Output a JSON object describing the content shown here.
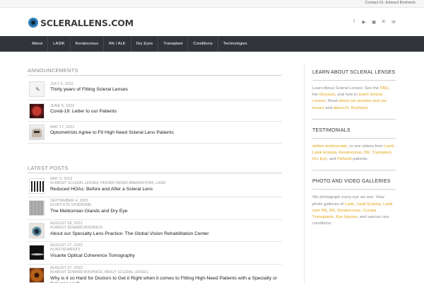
{
  "topbar": {
    "contact": "Contact Dr. Edward Boshnick"
  },
  "header": {
    "logo_text": "SCLERALLENS.COM",
    "social": [
      "facebook-icon",
      "youtube-icon",
      "instagram-icon",
      "linkedin-icon",
      "twitter-icon"
    ],
    "social_glyphs": [
      "f",
      "▶",
      "▣",
      "in",
      "✉"
    ]
  },
  "nav": {
    "items": [
      "About",
      "LASIK",
      "Keratoconus",
      "RK / ALK",
      "Dry Eyes",
      "Transplant",
      "Conditions",
      "Technologies"
    ]
  },
  "announcements": {
    "title": "ANNOUNCEMENTS",
    "items": [
      {
        "date": "JULY 6, 2022",
        "title": "Thirty years of Fitting Scleral Lenses"
      },
      {
        "date": "JUNE 5, 2022",
        "title": "Covid-19: Letter to our Patients"
      },
      {
        "date": "MAY 17, 2022",
        "title": "Optometrists Agree to Fit High Need Scleral Lens Patients"
      }
    ]
  },
  "latest": {
    "title": "LATEST POSTS",
    "items": [
      {
        "date": "MAY 2, 2023",
        "cats": "IN ABOUT SCLERAL LENSES, HIGHER ORDER ABERRATIONS, LASIK",
        "title": "Reduced HOAs: Before and After a Scleral Lens"
      },
      {
        "date": "SEPTEMBER 4, 2022",
        "cats": "IN DRY EYE SYNDROME",
        "title": "The Meibomian Glands and Dry Eye"
      },
      {
        "date": "AUGUST 28, 2022",
        "cats": "IN ABOUT EDWARD BOSHNICK",
        "title": "About our Specialty Lens Practice: The Global Vision Rehabilitation Center"
      },
      {
        "date": "AUGUST 27, 2022",
        "cats": "IN INSTRUMENTS",
        "title": "Visante Optical Coherence Tomography"
      },
      {
        "date": "AUGUST 27, 2022",
        "cats": "IN ABOUT EDWARD BOSHNICK, ABOUT SCLERAL LENSES",
        "title": "Why is it so Hard for Doctors to Get it Right when it comes to Fitting High-Need Patients with a Specialty or Scleral Lens?"
      }
    ]
  },
  "sidebar": {
    "learn": {
      "title": "LEARN ABOUT SCLERAL LENSES",
      "t1": "Learn About Scleral Lenses: See the",
      "l1": "FAQ",
      "t2": ", the",
      "l2": "Glossary",
      "t3": ", and how to",
      "l3": "Insert Scleral Lenses",
      "t4": ". Read",
      "l4": "about our practice and our lenses",
      "t5": "and",
      "l5": "about Dr. Boshnick",
      "t6": "."
    },
    "testimonials": {
      "title": "TESTIMONIALS",
      "l1": "written testimonials",
      "t1": ", or see videos from",
      "l2": "Lasik",
      "t2": ",",
      "l3": "Lasik Ectasia",
      "t3": ",",
      "l4": "Keratoconus",
      "t4": ",",
      "l5": "RK",
      "t5": ",",
      "l6": "Transplant",
      "t6": ",",
      "l7": "Dry Eye",
      "t7": ", and",
      "l8": "Pellucid",
      "t8": "patients."
    },
    "gallery": {
      "title": "PHOTO AND VIDEO GALLERIES",
      "t1": "We photograph every eye we see. View photo galleries of",
      "l1": "Lasik",
      "t2": ",",
      "l2": "Lasik Ectasia",
      "t3": ",",
      "l3": "Lasik over RK",
      "t4": ",",
      "l4": "RK",
      "t5": ",",
      "l5": "Keratoconus",
      "t6": ",",
      "l6": "Cornea Transplants",
      "t7": ",",
      "l7": "Eye Injuries",
      "t8": ", and various rare conditions."
    }
  },
  "colors": {
    "nav_bg": "#31343a",
    "link": "#e0a514",
    "logo_blue": "#2f7fb9"
  }
}
